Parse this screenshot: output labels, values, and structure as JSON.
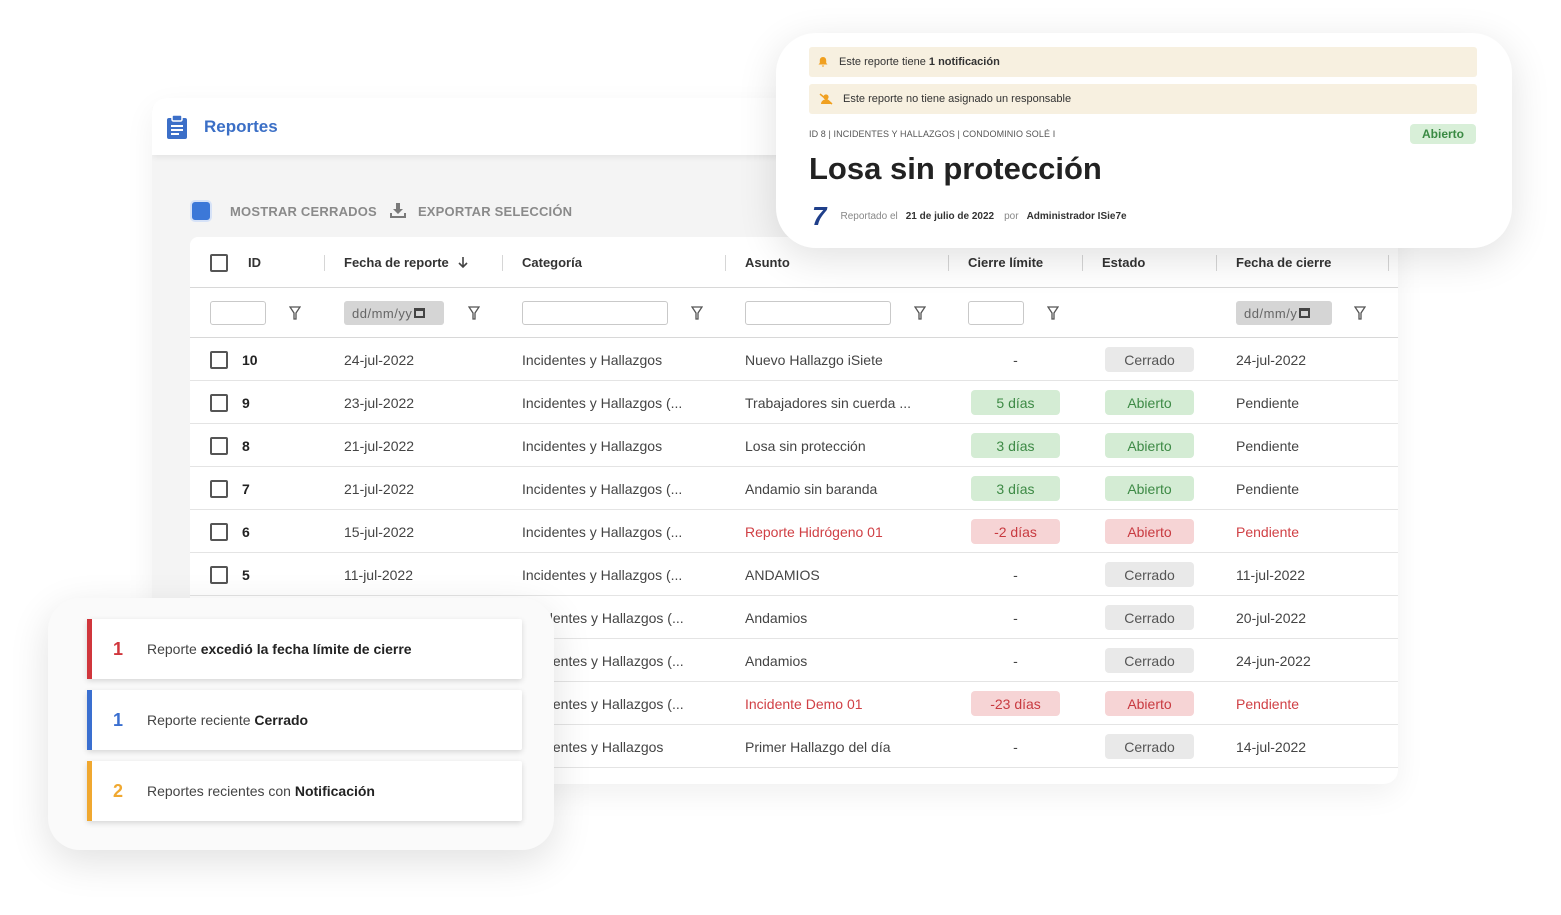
{
  "app": {
    "title": "Reportes",
    "icon": "clipboard-icon"
  },
  "toolbar": {
    "show_closed": "MOSTRAR CERRADOS",
    "export": "EXPORTAR SELECCIÓN",
    "export_icon": "download-icon"
  },
  "table": {
    "headers": {
      "id": "ID",
      "fecha": "Fecha de reporte",
      "categoria": "Categoría",
      "asunto": "Asunto",
      "cierre": "Cierre límite",
      "estado": "Estado",
      "fecha_cierre": "Fecha de cierre"
    },
    "date_placeholder": "dd/mm/yy",
    "date_placeholder_2": "dd/mm/y",
    "rows": [
      {
        "id": "10",
        "fecha": "24-jul-2022",
        "categoria": "Incidentes y Hallazgos",
        "asunto": "Nuevo Hallazgo iSiete",
        "cierre": "-",
        "estado": "Cerrado",
        "fecha_cierre": "24-jul-2022"
      },
      {
        "id": "9",
        "fecha": "23-jul-2022",
        "categoria": "Incidentes y Hallazgos (...",
        "asunto": "Trabajadores sin cuerda ...",
        "cierre": "5 días",
        "estado": "Abierto",
        "fecha_cierre": "Pendiente"
      },
      {
        "id": "8",
        "fecha": "21-jul-2022",
        "categoria": "Incidentes y Hallazgos",
        "asunto": "Losa sin protección",
        "cierre": "3 días",
        "estado": "Abierto",
        "fecha_cierre": "Pendiente"
      },
      {
        "id": "7",
        "fecha": "21-jul-2022",
        "categoria": "Incidentes y Hallazgos (...",
        "asunto": "Andamio sin baranda",
        "cierre": "3 días",
        "estado": "Abierto",
        "fecha_cierre": "Pendiente"
      },
      {
        "id": "6",
        "fecha": "15-jul-2022",
        "categoria": "Incidentes y Hallazgos (...",
        "asunto": "Reporte Hidrógeno 01",
        "cierre": "-2 días",
        "estado": "Abierto",
        "fecha_cierre": "Pendiente"
      },
      {
        "id": "5",
        "fecha": "11-jul-2022",
        "categoria": "Incidentes y Hallazgos (...",
        "asunto": "ANDAMIOS",
        "cierre": "-",
        "estado": "Cerrado",
        "fecha_cierre": "11-jul-2022"
      },
      {
        "categoria": "identes y Hallazgos (...",
        "asunto": "Andamios",
        "cierre": "-",
        "estado": "Cerrado",
        "fecha_cierre": "20-jul-2022"
      },
      {
        "categoria": "identes y Hallazgos (...",
        "asunto": "Andamios",
        "cierre": "-",
        "estado": "Cerrado",
        "fecha_cierre": "24-jun-2022"
      },
      {
        "categoria": "identes y Hallazgos (...",
        "asunto": "Incidente Demo 01",
        "cierre": "-23 días",
        "estado": "Abierto",
        "fecha_cierre": "Pendiente"
      },
      {
        "categoria": "identes y Hallazgos",
        "asunto": "Primer Hallazgo del día",
        "cierre": "-",
        "estado": "Cerrado",
        "fecha_cierre": "14-jul-2022"
      }
    ]
  },
  "detail": {
    "notice1": {
      "pre": "Este reporte tiene ",
      "bold": "1 notificación",
      "icon": "bell-icon"
    },
    "notice2": {
      "text": "Este reporte no tiene asignado un responsable",
      "icon": "no-user-icon"
    },
    "meta": "ID 8 | INCIDENTES Y HALLAZGOS | CONDOMINIO SOLÉ I",
    "status": "Abierto",
    "title": "Losa sin protección",
    "logo": "7",
    "reported_label": "Reportado el",
    "reported_date": "21 de julio de 2022",
    "by_label": "por",
    "by_user": "Administrador ISie7e"
  },
  "notifications": [
    {
      "num": "1",
      "pre": "Reporte ",
      "bold": "excedió la fecha límite de cierre",
      "color": "#d0363c"
    },
    {
      "num": "1",
      "pre": "Reporte reciente ",
      "bold": "Cerrado",
      "color": "#3a6fd0"
    },
    {
      "num": "2",
      "pre": "Reportes recientes con ",
      "bold": "Notificación",
      "color": "#f0a830"
    }
  ],
  "colors": {
    "accent": "#3b6fc6",
    "open": "#3d8a45",
    "overdue": "#d04045"
  }
}
